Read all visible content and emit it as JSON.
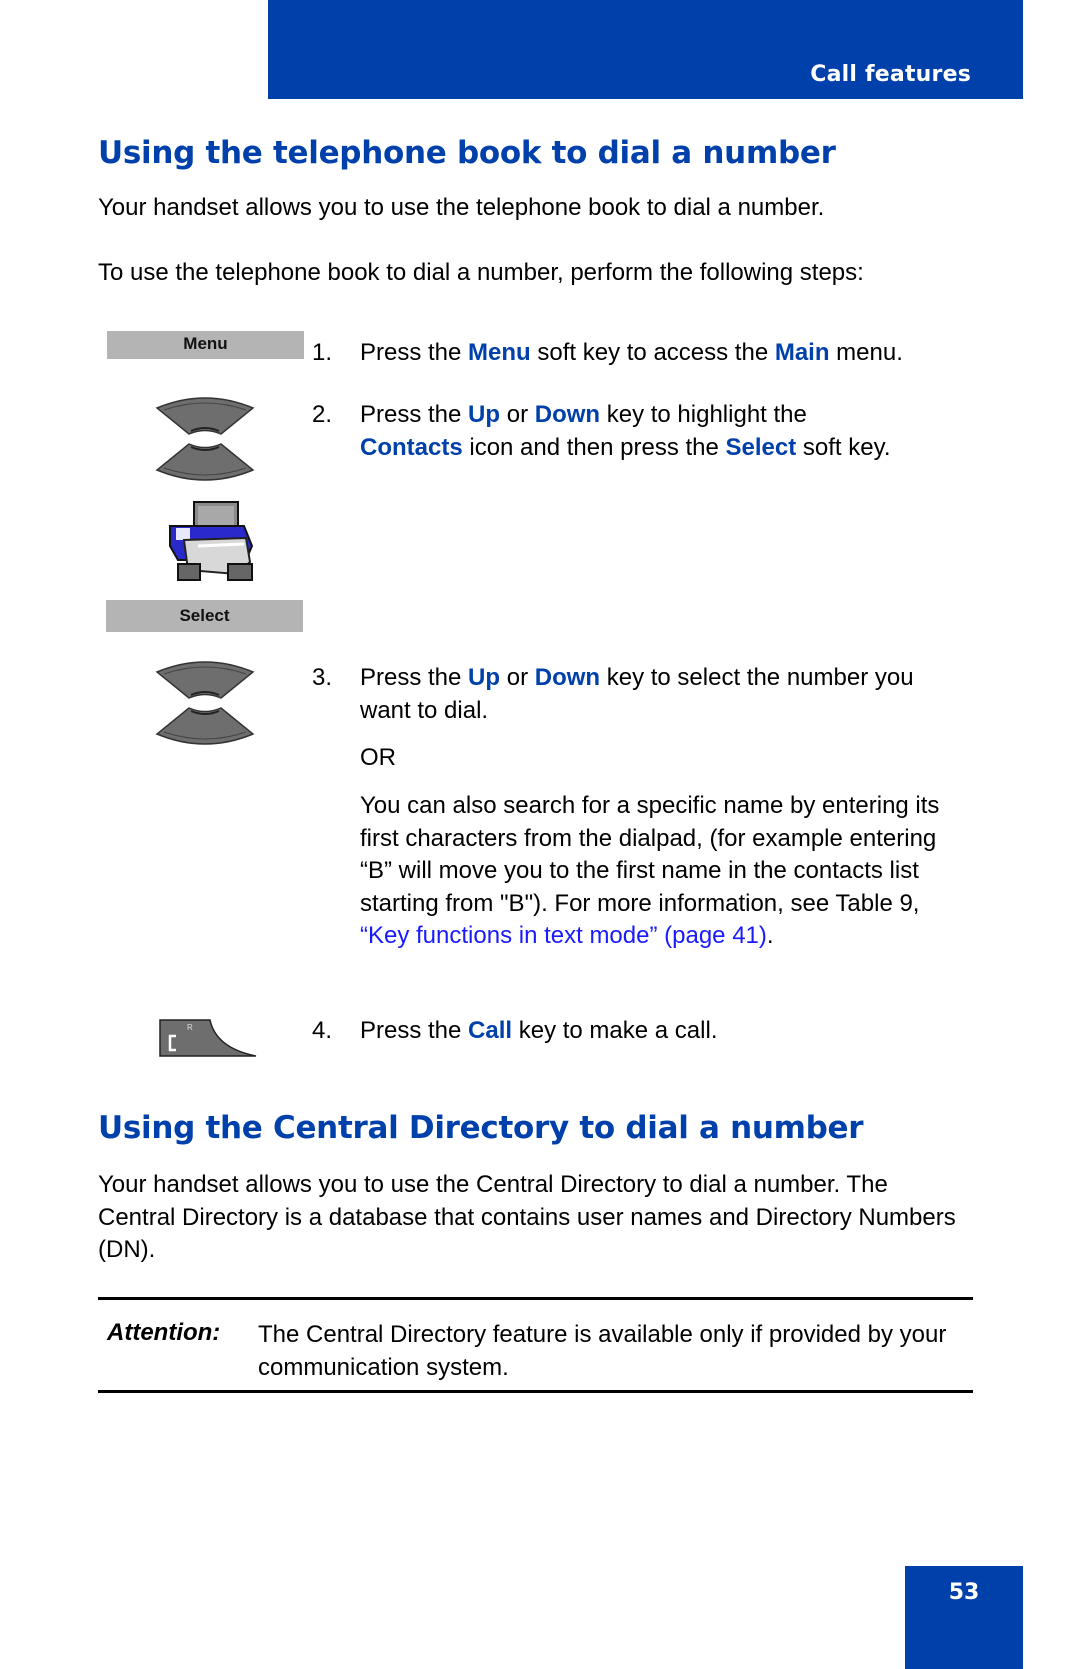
{
  "header": {
    "section": "Call features"
  },
  "section1": {
    "title": "Using the telephone book to dial a number",
    "intro": "Your handset allows you to use the telephone book to dial a number.",
    "lead": "To use the telephone book to dial a number, perform the following steps:",
    "soft_keys": {
      "menu": "Menu",
      "select": "Select"
    },
    "steps": [
      {
        "num": "1.",
        "parts": [
          "Press the ",
          "Menu",
          " soft key to access the ",
          "Main",
          " menu."
        ]
      },
      {
        "num": "2.",
        "parts": [
          "Press the ",
          "Up",
          " or ",
          "Down",
          " key to highlight the ",
          "Contacts",
          " icon and then press the ",
          "Select",
          " soft key."
        ]
      },
      {
        "num": "3.",
        "parts": [
          "Press the ",
          "Up",
          " or ",
          "Down",
          " key to select the number you want to dial."
        ],
        "or": "OR",
        "alt": "You can also search for a specific name by entering its first characters from the dialpad, (for example entering “B” will move you to the first name in the contacts list starting from \"B\"). For more information, see Table 9, ",
        "link": "“Key functions in text mode” (page 41)",
        "alt_end": "."
      },
      {
        "num": "4.",
        "parts": [
          "Press the ",
          "Call",
          " key to make a call."
        ]
      }
    ]
  },
  "section2": {
    "title": "Using the Central Directory to dial a number",
    "intro": "Your handset allows you to use the Central Directory to dial a number. The Central Directory is a database that contains user names and Directory Numbers (DN).",
    "attention_label": "Attention:",
    "attention_text": "The Central Directory feature is available only if provided by your communication system."
  },
  "icons": {
    "nav_key": "up-down-navigation-key-icon",
    "contacts": "contacts-icon",
    "call_key": "call-key-icon"
  },
  "colors": {
    "brand_blue": "#0040ab",
    "link_blue": "#1a1aff",
    "soft_key_gray": "#b4b4b4"
  },
  "footer": {
    "page_number": "53"
  }
}
